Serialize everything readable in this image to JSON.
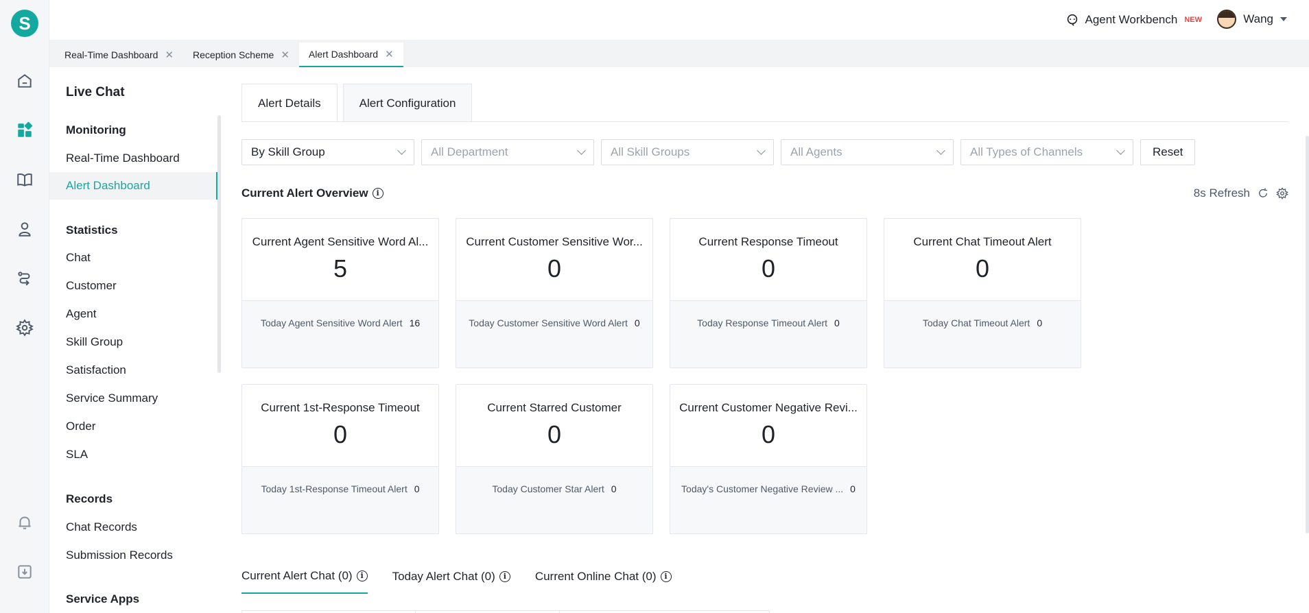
{
  "brand": {
    "logo_letter": "S",
    "accent": "#14a9a0"
  },
  "rail": {
    "icons": [
      "home-icon",
      "dashboard-icon",
      "book-icon",
      "user-icon",
      "routing-icon",
      "gear-icon",
      "bell-icon",
      "download-icon"
    ]
  },
  "header": {
    "agent_workbench": "Agent Workbench",
    "new_badge": "NEW",
    "user_name": "Wang"
  },
  "page_tabs": [
    {
      "label": "Real-Time Dashboard"
    },
    {
      "label": "Reception Scheme"
    },
    {
      "label": "Alert Dashboard"
    }
  ],
  "sidenav": {
    "title": "Live Chat",
    "groups": {
      "monitoring": "Monitoring",
      "statistics": "Statistics",
      "records": "Records",
      "service_apps": "Service Apps"
    },
    "items": {
      "realtime": "Real-Time Dashboard",
      "alert": "Alert Dashboard",
      "chat": "Chat",
      "customer": "Customer",
      "agent": "Agent",
      "skill_group": "Skill Group",
      "satisfaction": "Satisfaction",
      "service_summary": "Service Summary",
      "order": "Order",
      "sla": "SLA",
      "chat_records": "Chat Records",
      "submission_records": "Submission Records"
    }
  },
  "main": {
    "tabs": [
      "Alert Details",
      "Alert Configuration"
    ],
    "filters": {
      "group_by": "By Skill Group",
      "department": "All Department",
      "skill_groups": "All Skill Groups",
      "agents": "All Agents",
      "channels": "All Types of Channels",
      "reset": "Reset"
    },
    "overview_title": "Current Alert Overview",
    "refresh_label": "8s Refresh",
    "cards": [
      {
        "title": "Current Agent Sensitive Word Al...",
        "value": "5",
        "today_label": "Today Agent Sensitive Word Alert",
        "today_value": "16"
      },
      {
        "title": "Current Customer Sensitive Wor...",
        "value": "0",
        "today_label": "Today Customer Sensitive Word Alert",
        "today_value": "0"
      },
      {
        "title": "Current Response Timeout",
        "value": "0",
        "today_label": "Today Response Timeout Alert",
        "today_value": "0"
      },
      {
        "title": "Current Chat Timeout Alert",
        "value": "0",
        "today_label": "Today Chat Timeout Alert",
        "today_value": "0"
      },
      {
        "title": "Current 1st-Response Timeout",
        "value": "0",
        "today_label": "Today 1st-Response Timeout Alert",
        "today_value": "0"
      },
      {
        "title": "Current Starred Customer",
        "value": "0",
        "today_label": "Today Customer Star Alert",
        "today_value": "0"
      },
      {
        "title": "Current Customer Negative Revi...",
        "value": "0",
        "today_label": "Today's Customer Negative Review ...",
        "today_value": "0"
      }
    ],
    "bottom_tabs": [
      {
        "label": "Current Alert Chat (0)"
      },
      {
        "label": "Today Alert Chat (0)"
      },
      {
        "label": "Current Online Chat (0)"
      }
    ]
  }
}
